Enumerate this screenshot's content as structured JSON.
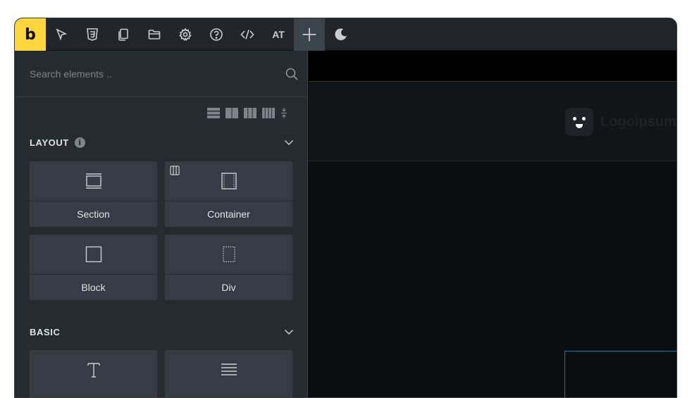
{
  "toolbar": {
    "logo": "b",
    "typography_label": "AT",
    "items": [
      "select-icon",
      "css3-icon",
      "pages-icon",
      "folder-icon",
      "gear-icon",
      "help-icon",
      "code-icon",
      "typography",
      "add-icon",
      "moon-icon"
    ]
  },
  "panel": {
    "search": {
      "placeholder": "Search elements .."
    },
    "groups": [
      {
        "title": "LAYOUT",
        "elements": [
          "Section",
          "Container",
          "Block",
          "Div"
        ]
      },
      {
        "title": "BASIC",
        "elements": [
          "Heading",
          "Text"
        ]
      }
    ]
  },
  "canvas": {
    "brand_name": "Logoipsum"
  },
  "colors": {
    "accent": "#ffd53d",
    "panel_bg": "#262b30",
    "tile_bg": "#353c43",
    "selection": "#2b6ea3"
  }
}
